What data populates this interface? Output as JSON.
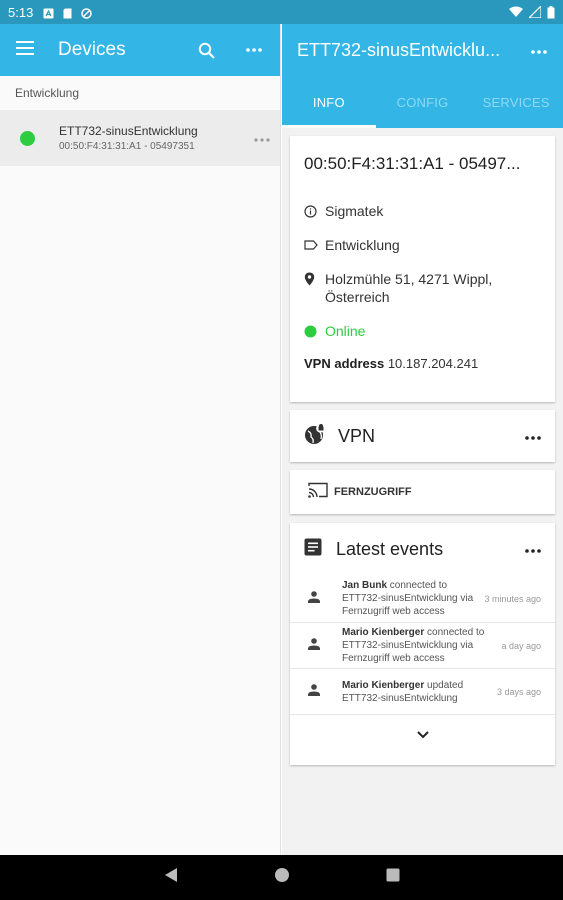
{
  "status_bar": {
    "time": "5:13"
  },
  "left_pane": {
    "title": "Devices",
    "group": "Entwicklung",
    "devices": [
      {
        "name": "ETT732-sinusEntwicklung",
        "subtitle": "00:50:F4:31:31:A1 - 05497351",
        "status_color": "#2ecc40"
      }
    ]
  },
  "right_pane": {
    "title": "ETT732-sinusEntwicklu...",
    "tabs": [
      "INFO",
      "CONFIG",
      "SERVICES"
    ],
    "active_tab": "INFO",
    "info": {
      "id": "00:50:F4:31:31:A1 - 05497...",
      "manufacturer": "Sigmatek",
      "group": "Entwicklung",
      "address": "Holzmühle 51, 4271 Wippl, Österreich",
      "status": "Online",
      "vpn_label": "VPN address",
      "vpn_address": "10.187.204.241"
    },
    "vpn_card": {
      "label": "VPN"
    },
    "remote_card": {
      "label": "FERNZUGRIFF"
    },
    "events": {
      "title": "Latest events",
      "items": [
        {
          "user": "Jan Bunk",
          "text": "connected to ETT732-sinusEntwicklung via Fernzugriff web access",
          "time": "3 minutes ago"
        },
        {
          "user": "Mario Kienberger",
          "text": "connected to ETT732-sinusEntwicklung via Fernzugriff web access",
          "time": "a day ago"
        },
        {
          "user": "Mario Kienberger",
          "text": "updated ETT732-sinusEntwicklung",
          "time": "3 days ago"
        }
      ]
    }
  },
  "colors": {
    "appbar": "#33b5e5",
    "statusbar": "#2a98bd",
    "online": "#2ecc40"
  },
  "icons": [
    "menu-icon",
    "search-icon",
    "more-icon",
    "info-icon",
    "label-icon",
    "location-icon",
    "vpn-globe-icon",
    "cast-icon",
    "article-icon",
    "person-icon",
    "chevron-down-icon",
    "back-icon",
    "home-icon",
    "recents-icon"
  ]
}
